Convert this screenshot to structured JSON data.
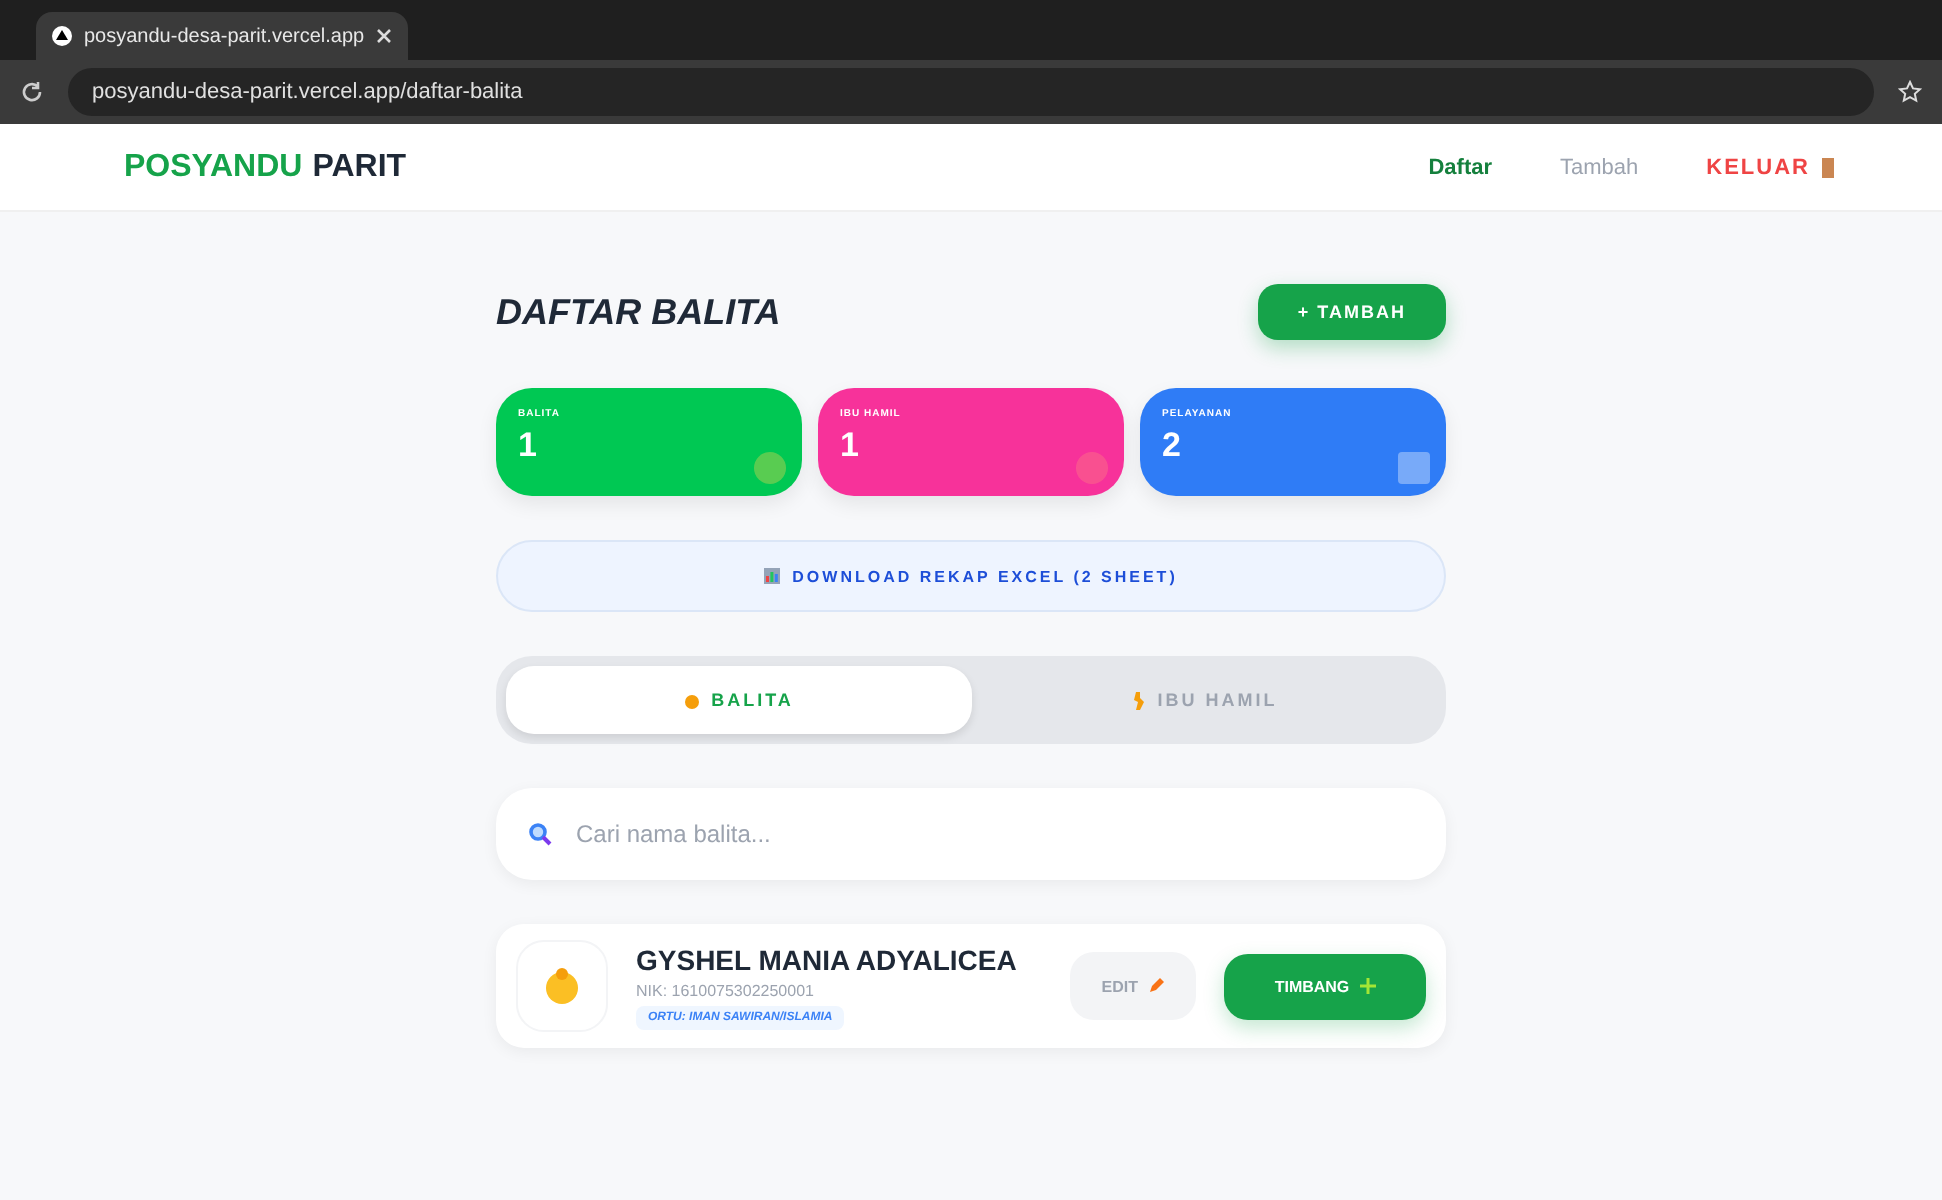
{
  "browser": {
    "tab_title": "posyandu-desa-parit.vercel.app",
    "url": "posyandu-desa-parit.vercel.app/daftar-balita"
  },
  "header": {
    "brand_first": "POSYANDU",
    "brand_second": "PARIT",
    "links": [
      {
        "label": "Daftar",
        "selected": true
      },
      {
        "label": "Tambah",
        "selected": false
      }
    ],
    "logout": "KELUAR"
  },
  "page": {
    "title": "DAFTAR BALITA",
    "add_button": "+ TAMBAH"
  },
  "stats": [
    {
      "label": "BALITA",
      "value": "1",
      "color": "#00c853"
    },
    {
      "label": "IBU HAMIL",
      "value": "1",
      "color": "#f7329a"
    },
    {
      "label": "PELAYANAN",
      "value": "2",
      "color": "#2f7cf6"
    }
  ],
  "download_button": "DOWNLOAD REKAP EXCEL (2 SHEET)",
  "tabs": [
    {
      "label": "BALITA",
      "selected": true
    },
    {
      "label": "IBU HAMIL",
      "selected": false
    }
  ],
  "search": {
    "placeholder": "Cari nama balita..."
  },
  "records": [
    {
      "name": "GYSHEL MANIA ADYALICEA",
      "nik": "NIK: 1610075302250001",
      "parent": "ORTU: IMAN SAWIRAN/ISLAMIA",
      "edit": "EDIT",
      "weigh": "TIMBANG"
    }
  ]
}
